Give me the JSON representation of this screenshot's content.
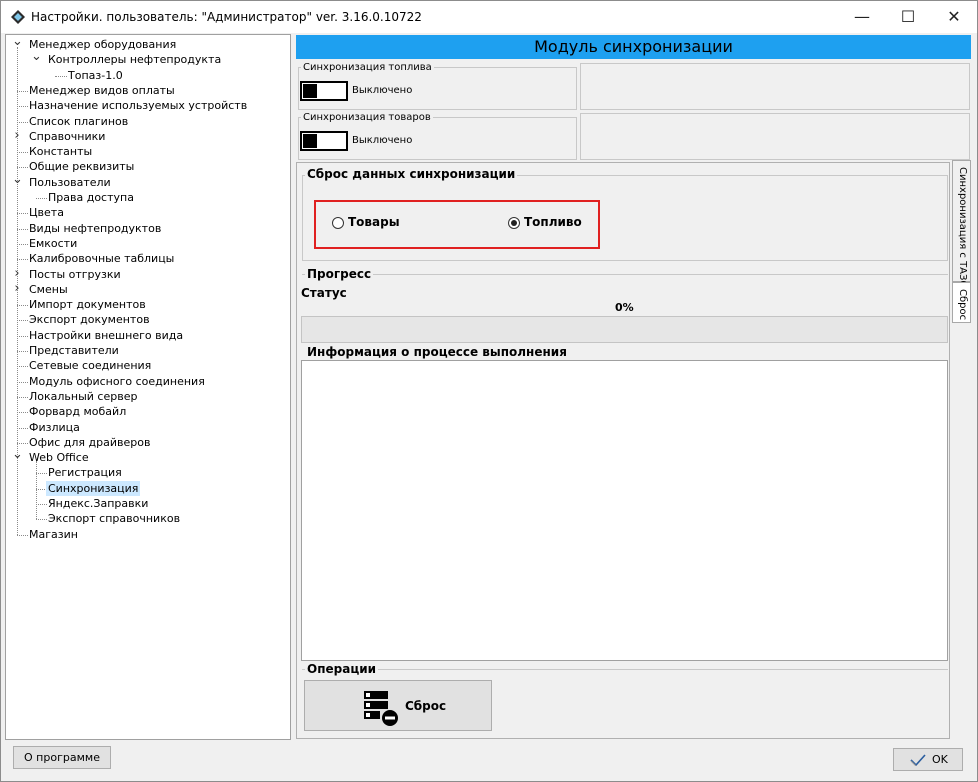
{
  "window": {
    "title": "Настройки. пользователь: \"Администратор\" ver. 3.16.0.10722",
    "minimize_glyph": "—",
    "maximize_glyph": "☐",
    "close_glyph": "✕"
  },
  "tree": {
    "items": [
      {
        "label": "Менеджер оборудования",
        "level": 0,
        "expander": "v"
      },
      {
        "label": "Контроллеры нефтепродукта",
        "level": 1,
        "expander": "v"
      },
      {
        "label": "Топаз-1.0",
        "level": 2,
        "expander": ""
      },
      {
        "label": "Менеджер видов оплаты",
        "level": 0,
        "expander": ""
      },
      {
        "label": "Назначение используемых устройств",
        "level": 0,
        "expander": ""
      },
      {
        "label": "Список плагинов",
        "level": 0,
        "expander": ""
      },
      {
        "label": "Справочники",
        "level": 0,
        "expander": ">"
      },
      {
        "label": "Константы",
        "level": 0,
        "expander": ""
      },
      {
        "label": "Общие реквизиты",
        "level": 0,
        "expander": ""
      },
      {
        "label": "Пользователи",
        "level": 0,
        "expander": "v"
      },
      {
        "label": "Права доступа",
        "level": 1,
        "expander": ""
      },
      {
        "label": "Цвета",
        "level": 0,
        "expander": ""
      },
      {
        "label": "Виды нефтепродуктов",
        "level": 0,
        "expander": ""
      },
      {
        "label": "Емкости",
        "level": 0,
        "expander": ""
      },
      {
        "label": "Калибровочные таблицы",
        "level": 0,
        "expander": ""
      },
      {
        "label": "Посты отгрузки",
        "level": 0,
        "expander": ">"
      },
      {
        "label": "Смены",
        "level": 0,
        "expander": ">"
      },
      {
        "label": "Импорт документов",
        "level": 0,
        "expander": ""
      },
      {
        "label": "Экспорт документов",
        "level": 0,
        "expander": ""
      },
      {
        "label": "Настройки внешнего вида",
        "level": 0,
        "expander": ""
      },
      {
        "label": "Представители",
        "level": 0,
        "expander": ""
      },
      {
        "label": "Сетевые соединения",
        "level": 0,
        "expander": ""
      },
      {
        "label": "Модуль офисного соединения",
        "level": 0,
        "expander": ""
      },
      {
        "label": "Локальный сервер",
        "level": 0,
        "expander": ""
      },
      {
        "label": "Форвард мобайл",
        "level": 0,
        "expander": ""
      },
      {
        "label": "Физлица",
        "level": 0,
        "expander": ""
      },
      {
        "label": "Офис для драйверов",
        "level": 0,
        "expander": ""
      },
      {
        "label": "Web Office",
        "level": 0,
        "expander": "v"
      },
      {
        "label": "Регистрация",
        "level": 1,
        "expander": ""
      },
      {
        "label": "Синхронизация",
        "level": 1,
        "expander": "",
        "selected": true
      },
      {
        "label": "Яндекс.Заправки",
        "level": 1,
        "expander": ""
      },
      {
        "label": "Экспорт справочников",
        "level": 1,
        "expander": ""
      },
      {
        "label": "Магазин",
        "level": 0,
        "expander": ""
      }
    ]
  },
  "module": {
    "header": "Модуль синхронизации",
    "fuel_sync": {
      "label": "Синхронизация топлива",
      "state": "Выключено"
    },
    "goods_sync": {
      "label": "Синхронизация товаров",
      "state": "Выключено"
    },
    "reset_section": {
      "title": "Сброс данных синхронизации",
      "options": [
        {
          "label": "Товары",
          "checked": false
        },
        {
          "label": "Топливо",
          "checked": true
        }
      ]
    },
    "progress": {
      "title": "Прогресс",
      "status_label": "Статус",
      "percent_text": "0%",
      "value": 0
    },
    "info": {
      "title": "Информация о процессе выполнения"
    },
    "operations": {
      "title": "Операции",
      "reset_button": "Сброс"
    },
    "side_tabs": [
      {
        "label": "Синхронизация с ТАЗС"
      },
      {
        "label": "Сброс"
      }
    ]
  },
  "footer": {
    "about_button": "О программе",
    "ok_button": "OK"
  },
  "colors": {
    "header_bg": "#1ea0f0",
    "highlight_border": "#e02020",
    "selection_bg": "#cce8ff"
  }
}
